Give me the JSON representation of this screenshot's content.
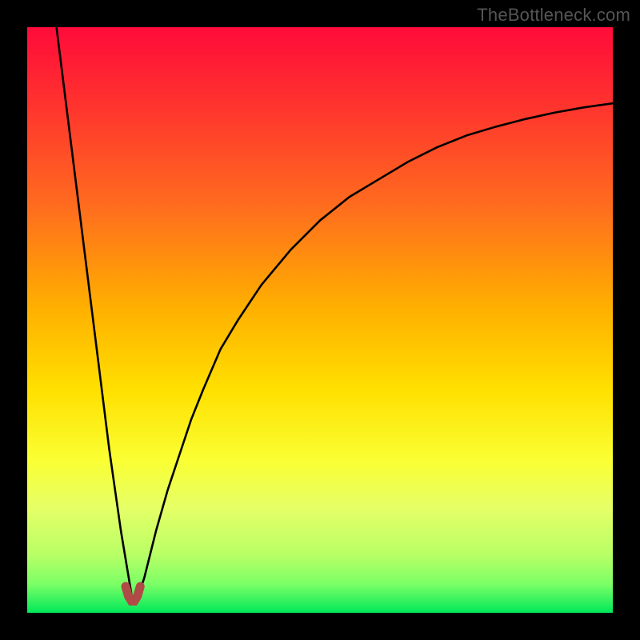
{
  "watermark": "TheBottleneck.com",
  "chart_data": {
    "type": "line",
    "title": "",
    "xlabel": "",
    "ylabel": "",
    "xlim": [
      0,
      100
    ],
    "ylim": [
      0,
      100
    ],
    "grid": false,
    "legend": false,
    "notes": "Bottleneck-style V-curve over a vertical red→yellow→green gradient. Minimum around x≈18, y≈2. Curve color black; small maroon marker segment at the trough.",
    "gradient_stops": [
      {
        "offset": 0.0,
        "color": "#ff0b3a"
      },
      {
        "offset": 0.12,
        "color": "#ff2f2f"
      },
      {
        "offset": 0.3,
        "color": "#ff6a1f"
      },
      {
        "offset": 0.48,
        "color": "#ffb000"
      },
      {
        "offset": 0.62,
        "color": "#ffe000"
      },
      {
        "offset": 0.74,
        "color": "#faff33"
      },
      {
        "offset": 0.82,
        "color": "#e6ff66"
      },
      {
        "offset": 0.9,
        "color": "#b9ff66"
      },
      {
        "offset": 0.95,
        "color": "#7dff66"
      },
      {
        "offset": 1.0,
        "color": "#00e85a"
      }
    ],
    "series": [
      {
        "name": "bottleneck-curve",
        "color": "#000000",
        "x": [
          5,
          6,
          7,
          8,
          9,
          10,
          11,
          12,
          13,
          14,
          15,
          16,
          17,
          18,
          19,
          20,
          21,
          22,
          24,
          26,
          28,
          30,
          33,
          36,
          40,
          45,
          50,
          55,
          60,
          65,
          70,
          75,
          80,
          85,
          90,
          95,
          100
        ],
        "y": [
          100,
          92,
          84,
          76,
          68,
          60,
          52,
          44,
          36,
          28,
          21,
          14,
          8,
          2,
          3,
          6,
          10,
          14,
          21,
          27,
          33,
          38,
          45,
          50,
          56,
          62,
          67,
          71,
          74,
          77,
          79.5,
          81.5,
          83,
          84.3,
          85.4,
          86.3,
          87
        ]
      },
      {
        "name": "trough-marker",
        "color": "#b04a46",
        "x": [
          16.8,
          17.3,
          17.8,
          18.3,
          18.8,
          19.3
        ],
        "y": [
          4.5,
          2.8,
          2.0,
          2.0,
          2.8,
          4.5
        ]
      }
    ]
  }
}
